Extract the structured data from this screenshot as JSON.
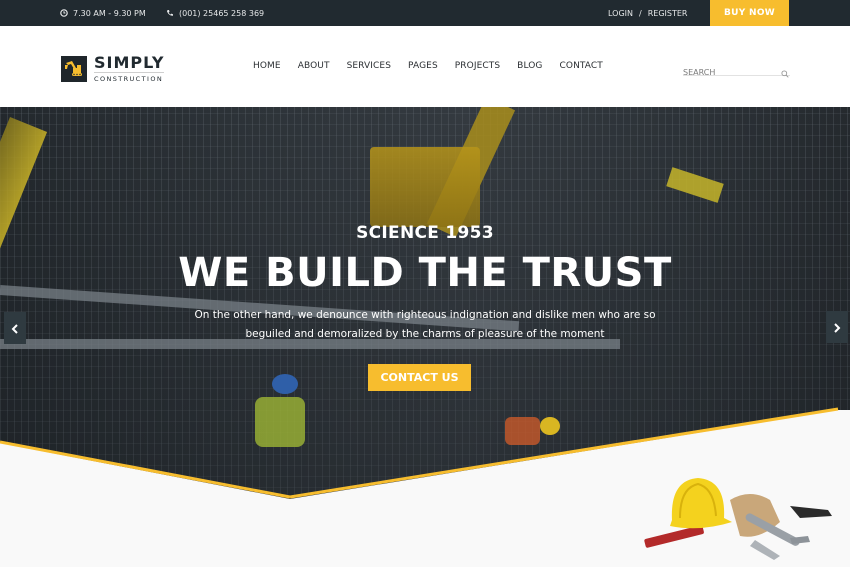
{
  "topbar": {
    "hours_icon": "clock-icon",
    "hours": "7.30 AM - 9.30 PM",
    "phone_icon": "phone-icon",
    "phone": "(001) 25465 258 369",
    "login": "LOGIN",
    "separator": "/",
    "register": "REGISTER",
    "buy_now": "BUY NOW"
  },
  "brand": {
    "icon": "excavator-icon",
    "title": "SIMPLY",
    "subtitle": "CONSTRUCTION"
  },
  "nav": {
    "items": [
      {
        "label": "HOME"
      },
      {
        "label": "ABOUT"
      },
      {
        "label": "SERVICES"
      },
      {
        "label": "PAGES"
      },
      {
        "label": "PROJECTS"
      },
      {
        "label": "BLOG"
      },
      {
        "label": "CONTACT"
      }
    ]
  },
  "search": {
    "placeholder": "SEARCH",
    "value": "",
    "icon": "search-icon"
  },
  "hero": {
    "eyebrow": "SCIENCE 1953",
    "headline": "WE BUILD THE TRUST",
    "description_line1": "On the other hand, we denounce with righteous indignation and dislike men who are so",
    "description_line2": "beguiled and demoralized by the charms of pleasure of the moment",
    "cta": "CONTACT US",
    "prev_icon": "chevron-left-icon",
    "next_icon": "chevron-right-icon"
  },
  "colors": {
    "accent": "#f7bd2e",
    "topbar_bg": "#212a30",
    "text_dark": "#2b2f33"
  }
}
